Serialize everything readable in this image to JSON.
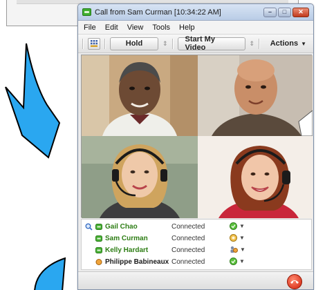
{
  "window": {
    "title": "Call from Sam Curman [10:34:22 AM]",
    "minimize_icon": "minimize-icon",
    "maximize_icon": "maximize-icon",
    "close_icon": "close-icon"
  },
  "menu": [
    "File",
    "Edit",
    "View",
    "Tools",
    "Help"
  ],
  "toolbar": {
    "hold_label": "Hold",
    "video_label": "Start My Video",
    "actions_label": "Actions"
  },
  "participants": [
    {
      "name": "Gail Chao",
      "status": "Connected",
      "name_color": "#2d7d14",
      "status_icon": "green-status-icon",
      "selected": true
    },
    {
      "name": "Sam Curman",
      "status": "Connected",
      "name_color": "#2d7d14",
      "status_icon": "amber-status-icon",
      "selected": false
    },
    {
      "name": "Kelly Hardart",
      "status": "Connected",
      "name_color": "#2d7d14",
      "status_icon": "conference-status-icon",
      "selected": false
    },
    {
      "name": "Philippe Babineaux",
      "status": "Connected",
      "name_color": "#1b1b1b",
      "status_icon": "green-status-icon",
      "selected": false
    }
  ],
  "colors": {
    "accent_arrow": "#2aa7f0",
    "online_green": "#2d7d14",
    "hangup_red": "#d11d07"
  }
}
